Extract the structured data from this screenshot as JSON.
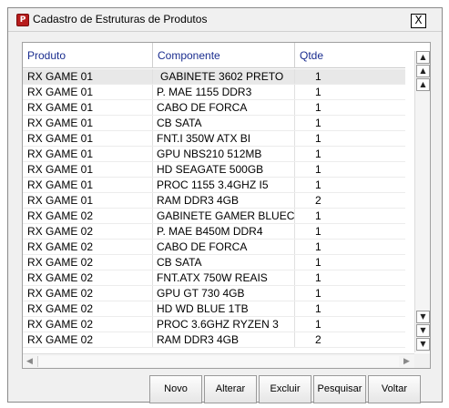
{
  "window": {
    "title": "Cadastro de Estruturas de Produtos",
    "icon": "app-icon",
    "close_label": "X"
  },
  "grid": {
    "columns": [
      "Produto",
      "Componente",
      "Qtde"
    ],
    "rows": [
      {
        "produto": "RX GAME 01",
        "componente": "GABINETE 3602 PRETO",
        "qtde": "1",
        "selected": true
      },
      {
        "produto": "RX GAME 01",
        "componente": "P. MAE 1155 DDR3",
        "qtde": "1"
      },
      {
        "produto": "RX GAME 01",
        "componente": "CABO DE FORCA",
        "qtde": "1"
      },
      {
        "produto": "RX GAME 01",
        "componente": "CB SATA",
        "qtde": "1"
      },
      {
        "produto": "RX GAME 01",
        "componente": "FNT.I 350W ATX BI",
        "qtde": "1"
      },
      {
        "produto": "RX GAME 01",
        "componente": "GPU NBS210 512MB",
        "qtde": "1"
      },
      {
        "produto": "RX GAME 01",
        "componente": "HD SEAGATE 500GB",
        "qtde": "1"
      },
      {
        "produto": "RX GAME 01",
        "componente": "PROC 1155 3.4GHZ I5",
        "qtde": "1"
      },
      {
        "produto": "RX GAME 01",
        "componente": "RAM DDR3 4GB",
        "qtde": "2"
      },
      {
        "produto": "RX GAME 02",
        "componente": "GABINETE GAMER BLUEC",
        "qtde": "1"
      },
      {
        "produto": "RX GAME 02",
        "componente": "P. MAE B450M DDR4",
        "qtde": "1"
      },
      {
        "produto": "RX GAME 02",
        "componente": "CABO DE FORCA",
        "qtde": "1"
      },
      {
        "produto": "RX GAME 02",
        "componente": "CB SATA",
        "qtde": "1"
      },
      {
        "produto": "RX GAME 02",
        "componente": "FNT.ATX 750W REAIS",
        "qtde": "1"
      },
      {
        "produto": "RX GAME 02",
        "componente": "GPU GT 730 4GB",
        "qtde": "1"
      },
      {
        "produto": "RX GAME 02",
        "componente": "HD WD BLUE 1TB",
        "qtde": "1"
      },
      {
        "produto": "RX GAME 02",
        "componente": "PROC 3.6GHZ RYZEN 3",
        "qtde": "1"
      },
      {
        "produto": "RX GAME 02",
        "componente": "RAM DDR3 4GB",
        "qtde": "2"
      }
    ]
  },
  "scrollbars": {
    "vertical_top_icons": [
      "scroll-first-icon",
      "scroll-page-up-icon",
      "scroll-up-icon"
    ],
    "vertical_bottom_icons": [
      "scroll-down-icon",
      "scroll-page-down-icon",
      "scroll-last-icon"
    ]
  },
  "buttons": {
    "novo": "Novo",
    "alterar": "Alterar",
    "excluir": "Excluir",
    "pesquisar": "Pesquisar",
    "voltar": "Voltar"
  }
}
